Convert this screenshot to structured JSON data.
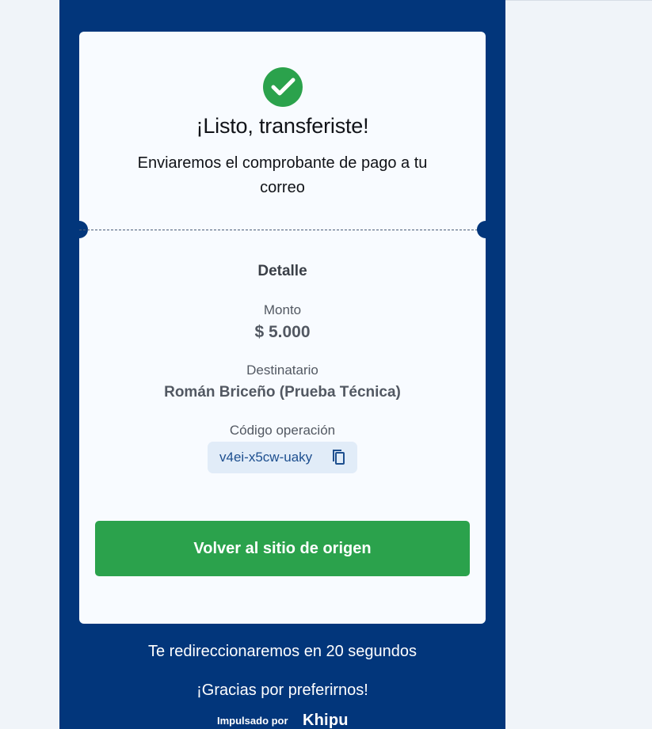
{
  "colors": {
    "page_background": "#f0f4f9",
    "panel": "#02367b",
    "card": "#f8fbff",
    "success": "#2ba24c",
    "code_background": "#e1ecf8",
    "code_text": "#1d4f8f",
    "text_dark": "#111318",
    "text_muted": "#525862"
  },
  "icons": {
    "success": "check-circle-icon",
    "copy": "copy-icon"
  },
  "confirmation": {
    "title": "¡Listo, transferiste!",
    "subtitle": "Enviaremos el comprobante de pago a tu correo"
  },
  "details": {
    "title": "Detalle",
    "amount_label": "Monto",
    "amount_value": "$ 5.000",
    "recipient_label": "Destinatario",
    "recipient_value": "Román Briceño (Prueba Técnica)",
    "operation_code_label": "Código operación",
    "operation_code_value": "v4ei-x5cw-uaky"
  },
  "actions": {
    "back_button_label": "Volver al sitio de origen"
  },
  "footer": {
    "redirect_message": "Te redireccionaremos en 20 segundos",
    "thanks_message": "¡Gracias por preferirnos!",
    "powered_by_label": "Impulsado por",
    "brand_name": "Khipu"
  }
}
